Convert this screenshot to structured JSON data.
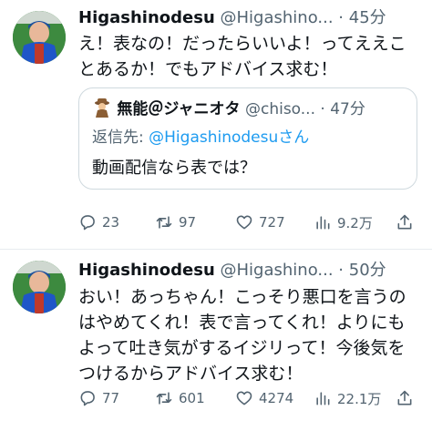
{
  "tweets": [
    {
      "name": "Higashinodesu",
      "handle": "@Higashino...",
      "dot": "·",
      "time": "45分",
      "text": "え！表なの！だったらいいよ！ってええことあるか！でもアドバイス求む！",
      "quote": {
        "name": "無能＠ジャニオタ",
        "handle": "@chiso...",
        "dot": "·",
        "time": "47分",
        "reply_prefix": "返信先: ",
        "reply_to": "@Higashinodesu",
        "reply_suffix": "さん",
        "text": "動画配信なら表では？"
      },
      "stats": {
        "replies": "23",
        "retweets": "97",
        "likes": "727",
        "views": "9.2万"
      }
    },
    {
      "name": "Higashinodesu",
      "handle": "@Higashino...",
      "dot": "·",
      "time": "50分",
      "text": "おい！あっちゃん！こっそり悪口を言うのはやめてくれ！表で言ってくれ！よりにもよって吐き気がするイジリって！今後気をつけるからアドバイス求む！",
      "stats": {
        "replies": "77",
        "retweets": "601",
        "likes": "4274",
        "views": "22.1万"
      }
    }
  ],
  "icons": [
    "reply-icon",
    "retweet-icon",
    "like-icon",
    "views-icon",
    "share-icon",
    "detective-emoji-icon"
  ],
  "colors": {
    "secondary_text": "#536471",
    "link": "#1d9bf0",
    "border": "#cfd9de"
  }
}
